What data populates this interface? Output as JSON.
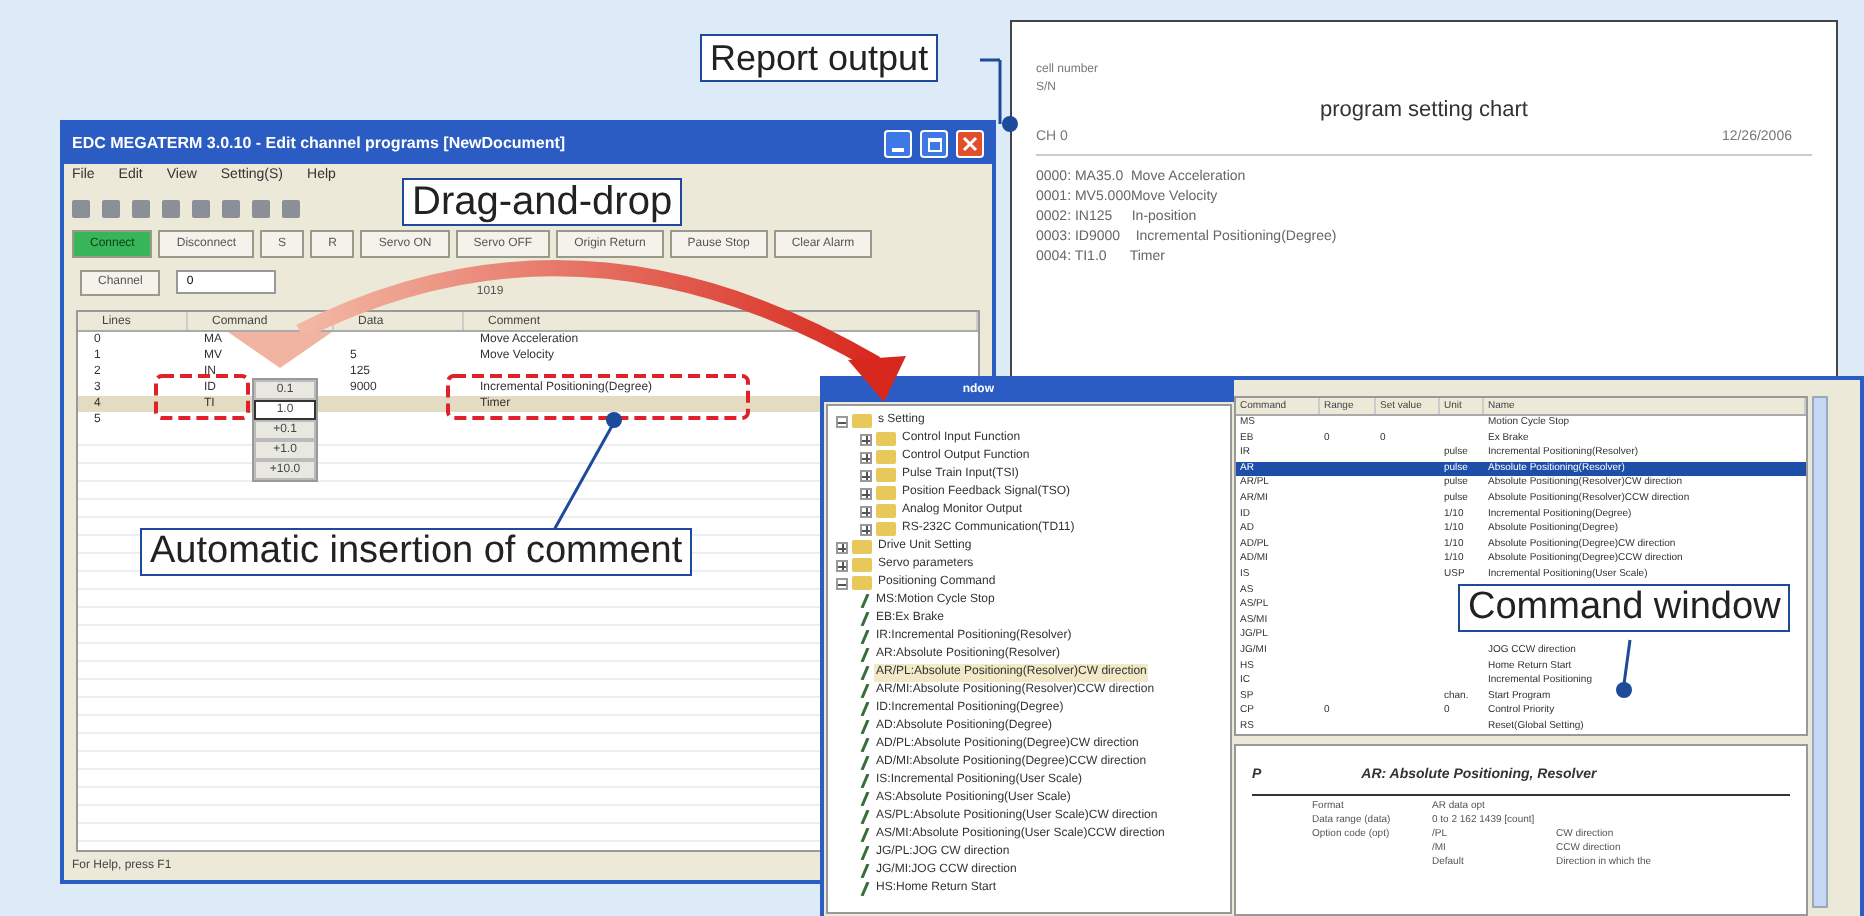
{
  "main_window": {
    "title": "EDC MEGATERM 3.0.10 - Edit channel programs [NewDocument]",
    "menu": [
      "File",
      "Edit",
      "View",
      "Setting(S)",
      "Help"
    ],
    "buttons": [
      {
        "label": "Connect",
        "kind": "connect"
      },
      {
        "label": "Disconnect",
        "kind": "plain"
      },
      {
        "label": "S",
        "kind": "plain"
      },
      {
        "label": "R",
        "kind": "plain"
      },
      {
        "label": "Servo ON",
        "kind": "plain"
      },
      {
        "label": "Servo OFF",
        "kind": "plain"
      },
      {
        "label": "Origin Return",
        "kind": "plain"
      },
      {
        "label": "Pause Stop",
        "kind": "plain"
      },
      {
        "label": "Clear Alarm",
        "kind": "plain"
      }
    ],
    "channel_label": "Channel",
    "channel_value": "0",
    "steps": "1019",
    "table": {
      "columns": [
        "Lines",
        "Command",
        "Data",
        "Comment"
      ],
      "rows": [
        {
          "cells": [
            "0",
            "MA",
            "",
            "Move Acceleration"
          ],
          "selected": false
        },
        {
          "cells": [
            "1",
            "MV",
            "5",
            "Move Velocity"
          ],
          "selected": false
        },
        {
          "cells": [
            "2",
            "IN",
            "125",
            ""
          ],
          "selected": false
        },
        {
          "cells": [
            "3",
            "ID",
            "9000",
            "Incremental Positioning(Degree)"
          ],
          "selected": false
        },
        {
          "cells": [
            "4",
            "TI",
            "",
            "Timer"
          ],
          "selected": true
        },
        {
          "cells": [
            "5",
            "",
            "",
            ""
          ],
          "selected": false
        }
      ]
    },
    "spinner": [
      {
        "label": "0.1",
        "selected": false
      },
      {
        "label": "1.0",
        "selected": true
      },
      {
        "label": "+0.1",
        "selected": false
      },
      {
        "label": "+1.0",
        "selected": false
      },
      {
        "label": "+10.0",
        "selected": false
      }
    ],
    "status_bar": "For Help, press F1"
  },
  "report": {
    "cell_number": "cell number",
    "sn": "S/N",
    "title": "program setting chart",
    "channel": "CH 0",
    "date": "12/26/2006",
    "lines": [
      "0000: MA35.0  Move Acceleration",
      "0001: MV5.000Move Velocity",
      "0002: IN125     In-position",
      "0003: ID9000    Incremental Positioning(Degree)",
      "0004: TI1.0      Timer"
    ]
  },
  "command_window": {
    "title": "ndow",
    "tree": [
      {
        "label": "s Setting",
        "expanded": true,
        "children": [
          {
            "label": "Control Input Function",
            "expanded": false
          },
          {
            "label": "Control Output Function",
            "expanded": false
          },
          {
            "label": "Pulse Train Input(TSI)",
            "expanded": false
          },
          {
            "label": "Position Feedback Signal(TSO)",
            "expanded": false
          },
          {
            "label": "Analog Monitor Output",
            "expanded": false
          },
          {
            "label": "RS-232C Communication(TD11)",
            "expanded": false
          }
        ]
      },
      {
        "label": "Drive Unit Setting",
        "expanded": false
      },
      {
        "label": "Servo parameters",
        "expanded": false
      },
      {
        "label": "Positioning Command",
        "expanded": true,
        "children": [
          {
            "label": "MS:Motion Cycle Stop",
            "selected": false
          },
          {
            "label": "EB:Ex Brake",
            "selected": false
          },
          {
            "label": "IR:Incremental Positioning(Resolver)",
            "selected": false
          },
          {
            "label": "AR:Absolute Positioning(Resolver)",
            "selected": false
          },
          {
            "label": "AR/PL:Absolute Positioning(Resolver)CW direction",
            "selected": true
          },
          {
            "label": "AR/MI:Absolute Positioning(Resolver)CCW direction",
            "selected": false
          },
          {
            "label": "ID:Incremental Positioning(Degree)",
            "selected": false
          },
          {
            "label": "AD:Absolute Positioning(Degree)",
            "selected": false
          },
          {
            "label": "AD/PL:Absolute Positioning(Degree)CW direction",
            "selected": false
          },
          {
            "label": "AD/MI:Absolute Positioning(Degree)CCW direction",
            "selected": false
          },
          {
            "label": "IS:Incremental Positioning(User Scale)",
            "selected": false
          },
          {
            "label": "AS:Absolute Positioning(User Scale)",
            "selected": false
          },
          {
            "label": "AS/PL:Absolute Positioning(User Scale)CW direction",
            "selected": false
          },
          {
            "label": "AS/MI:Absolute Positioning(User Scale)CCW direction",
            "selected": false
          },
          {
            "label": "JG/PL:JOG CW direction",
            "selected": false
          },
          {
            "label": "JG/MI:JOG CCW direction",
            "selected": false
          },
          {
            "label": "HS:Home Return Start",
            "selected": false
          }
        ]
      }
    ],
    "table": {
      "columns": [
        "Command",
        "Range",
        "Set value",
        "Unit",
        "Name"
      ],
      "rows": [
        {
          "cells": [
            "MS",
            "",
            "",
            "",
            "Motion Cycle Stop"
          ],
          "selected": false
        },
        {
          "cells": [
            "EB",
            "0",
            "0",
            "",
            "Ex Brake"
          ],
          "selected": false
        },
        {
          "cells": [
            "IR",
            "",
            "",
            "pulse",
            "Incremental Positioning(Resolver)"
          ],
          "selected": false
        },
        {
          "cells": [
            "AR",
            "",
            "",
            "pulse",
            "Absolute Positioning(Resolver)"
          ],
          "selected": true
        },
        {
          "cells": [
            "AR/PL",
            "",
            "",
            "pulse",
            "Absolute Positioning(Resolver)CW direction"
          ],
          "selected": false
        },
        {
          "cells": [
            "AR/MI",
            "",
            "",
            "pulse",
            "Absolute Positioning(Resolver)CCW direction"
          ],
          "selected": false
        },
        {
          "cells": [
            "ID",
            "",
            "",
            "1/10",
            "Incremental Positioning(Degree)"
          ],
          "selected": false
        },
        {
          "cells": [
            "AD",
            "",
            "",
            "1/10",
            "Absolute Positioning(Degree)"
          ],
          "selected": false
        },
        {
          "cells": [
            "AD/PL",
            "",
            "",
            "1/10",
            "Absolute Positioning(Degree)CW direction"
          ],
          "selected": false
        },
        {
          "cells": [
            "AD/MI",
            "",
            "",
            "1/10",
            "Absolute Positioning(Degree)CCW direction"
          ],
          "selected": false
        },
        {
          "cells": [
            "IS",
            "",
            "",
            "USP",
            "Incremental Positioning(User Scale)"
          ],
          "selected": false
        },
        {
          "cells": [
            "AS",
            "",
            "",
            "",
            ""
          ],
          "selected": false
        },
        {
          "cells": [
            "AS/PL",
            "",
            "",
            "",
            ""
          ],
          "selected": false
        },
        {
          "cells": [
            "AS/MI",
            "",
            "",
            "",
            ""
          ],
          "selected": false
        },
        {
          "cells": [
            "JG/PL",
            "",
            "",
            "",
            ""
          ],
          "selected": false
        },
        {
          "cells": [
            "JG/MI",
            "",
            "",
            "",
            "JOG CCW direction"
          ],
          "selected": false
        },
        {
          "cells": [
            "HS",
            "",
            "",
            "",
            "Home Return Start"
          ],
          "selected": false
        },
        {
          "cells": [
            "IC",
            "",
            "",
            "",
            "Incremental Positioning"
          ],
          "selected": false
        },
        {
          "cells": [
            "SP",
            "",
            "",
            "chan.",
            "Start Program"
          ],
          "selected": false
        },
        {
          "cells": [
            "CP",
            "0",
            "",
            "0",
            "Control Priority"
          ],
          "selected": false
        },
        {
          "cells": [
            "RS",
            "",
            "",
            "",
            "Reset(Global Setting)"
          ],
          "selected": false
        }
      ]
    },
    "detail": {
      "mark": "P",
      "title": "AR: Absolute Positioning, Resolver",
      "rows": [
        [
          "Format",
          "AR data opt",
          ""
        ],
        [
          "Data range (data)",
          "0 to 2 162 1439 [count]",
          ""
        ],
        [
          "Option code (opt)",
          "/PL",
          "CW direction"
        ],
        [
          "",
          "/MI",
          "CCW direction"
        ],
        [
          "",
          "Default",
          "Direction in which the"
        ]
      ]
    }
  },
  "callouts": [
    "Report output",
    "Drag-and-drop",
    "Automatic insertion of comment",
    "Command window"
  ]
}
